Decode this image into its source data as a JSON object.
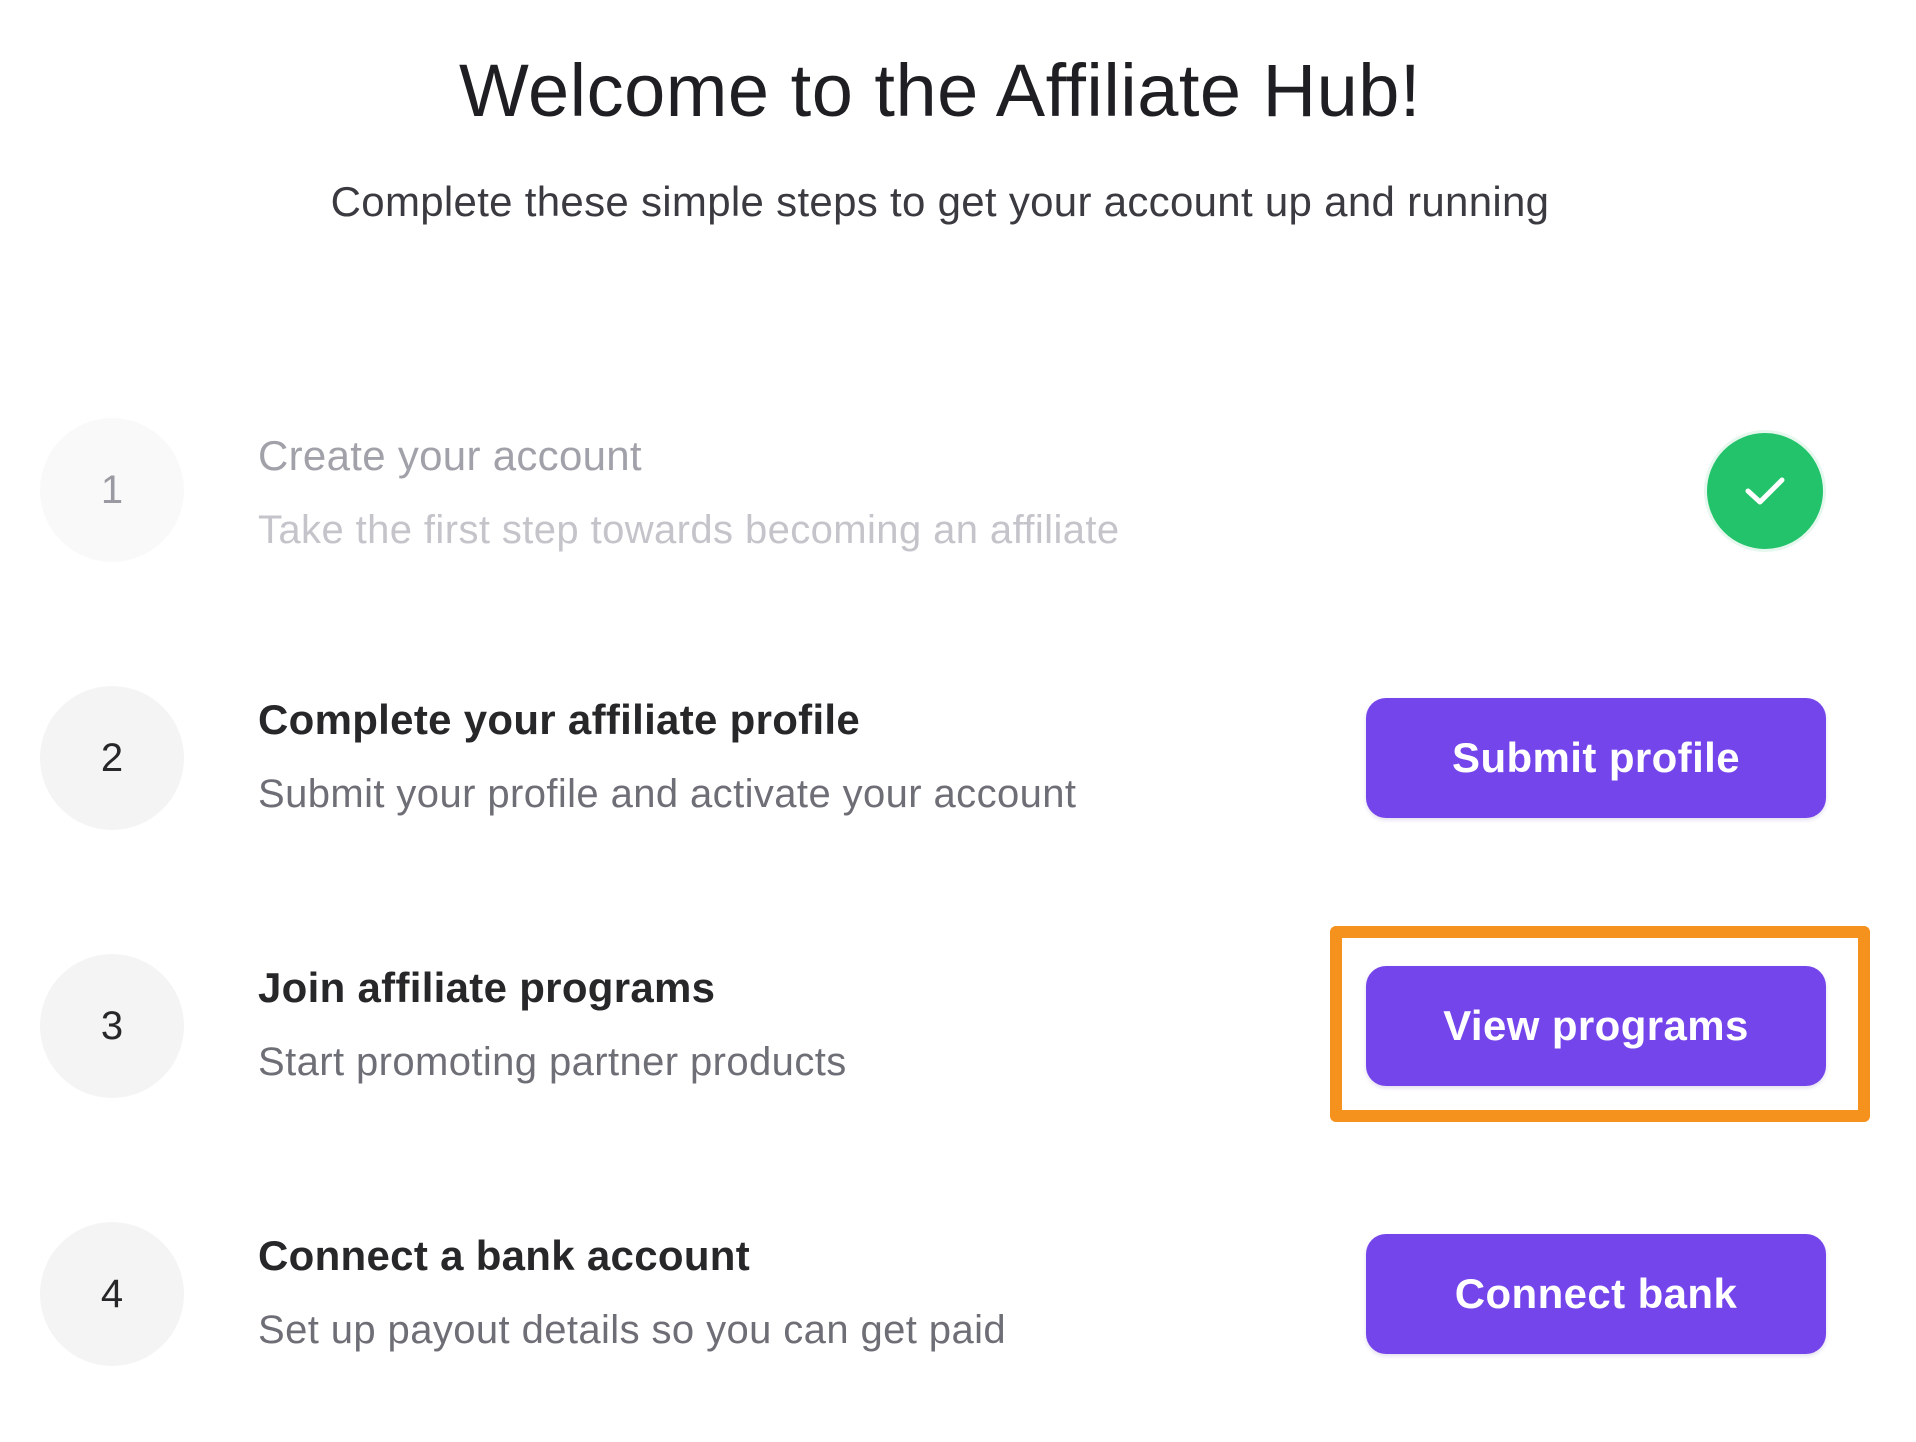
{
  "header": {
    "title": "Welcome to the Affiliate Hub!",
    "subtitle": "Complete these simple steps to get your account up and running"
  },
  "steps": [
    {
      "number": "1",
      "title": "Create your account",
      "description": "Take the first step towards becoming an affiliate",
      "status": "completed",
      "icon": "check-icon"
    },
    {
      "number": "2",
      "title": "Complete your affiliate profile",
      "description": "Submit your profile and activate your account",
      "button_label": "Submit profile"
    },
    {
      "number": "3",
      "title": "Join affiliate programs",
      "description": "Start promoting partner products",
      "button_label": "View programs",
      "highlighted": true
    },
    {
      "number": "4",
      "title": "Connect a bank account",
      "description": "Set up payout details so you can get paid",
      "button_label": "Connect bank"
    }
  ],
  "colors": {
    "accent": "#7445ea",
    "success": "#22c36b",
    "highlight": "#f5921d"
  }
}
